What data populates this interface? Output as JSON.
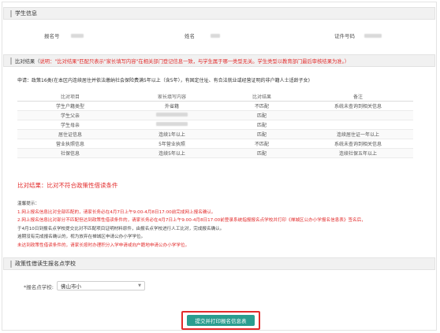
{
  "student_section": {
    "title": "学生信息",
    "fields": [
      {
        "label": "报名号"
      },
      {
        "label": "姓名"
      },
      {
        "label": "证件号码"
      }
    ]
  },
  "result_section": {
    "title": "比对结果（",
    "note": "说明：\"比对结果\"匹配只表示\"家长填写内容\"在相关部门登记信息一致，与学生属于哪一类型无关。学生类型以教育部门最后审核结果为准。）",
    "apply_text": "申请：政策16类(在本区内连续居住并依法缴纳社会保险费满5年以上（含5年），有固定住址、有合法就业或经营证明的非户籍人士适龄子女)",
    "table": {
      "headers": [
        "比对项目",
        "家长填写内容",
        "比对结果",
        "备注"
      ],
      "rows": [
        {
          "item": "学生户籍类型",
          "content": "外省籍",
          "result": "不匹配",
          "result_ok": false,
          "remark": "系统未查询到相关信息"
        },
        {
          "item": "学生父亲",
          "content": "",
          "result": "匹配",
          "result_ok": true,
          "remark": ""
        },
        {
          "item": "学生母亲",
          "content": "",
          "result": "匹配",
          "result_ok": true,
          "remark": ""
        },
        {
          "item": "居住证信息",
          "content": "连续1年以上",
          "result": "匹配",
          "result_ok": true,
          "remark": "连续居住证一年以上"
        },
        {
          "item": "营业执照信息",
          "content": "5年营业执照",
          "result": "不匹配",
          "result_ok": false,
          "remark": "系统未查询到相关信息"
        },
        {
          "item": "社保信息",
          "content": "连续5年以上",
          "result": "匹配",
          "result_ok": true,
          "remark": "连续社保五年以上"
        }
      ]
    },
    "conclusion": "比对结果：比对不符合政策性借读条件"
  },
  "notes": {
    "title": "温馨提示：",
    "lines": [
      "1.网上报名信息比对全部匹配的，请家长务必在4月7日上午9:00-4月8日17:00前完成网上报名确认。",
      "2.网上报名信息比对部分不匹配但达到政策性借读条件的，请家长务必在4月7日上午9:00-4月8日17:00前登录系统指报报名点学校并打印《禅城区公办小学报名信息表》签名后，",
      "于4月10日到报名点学校提交比对不匹配项目证明材料原件，由报名点学校进行人工比对，完成报名确认。",
      "逾期没有完成报名确认的，视为放弃在禅城区申请公办小学学位。",
      "未达到政策性借读条件的，请家长按时办理积分入学申请或向户籍地申请公办小学学位。"
    ]
  },
  "school_section": {
    "title": "政策性借读生报名点学校",
    "label": "*报名点学校:",
    "selected": "佛山市小"
  },
  "submit_button": "提交并打印报名信息表",
  "colors": {
    "accent": "#2a9d8f",
    "warning": "#e22b2b",
    "ok": "#1c9b4a"
  }
}
